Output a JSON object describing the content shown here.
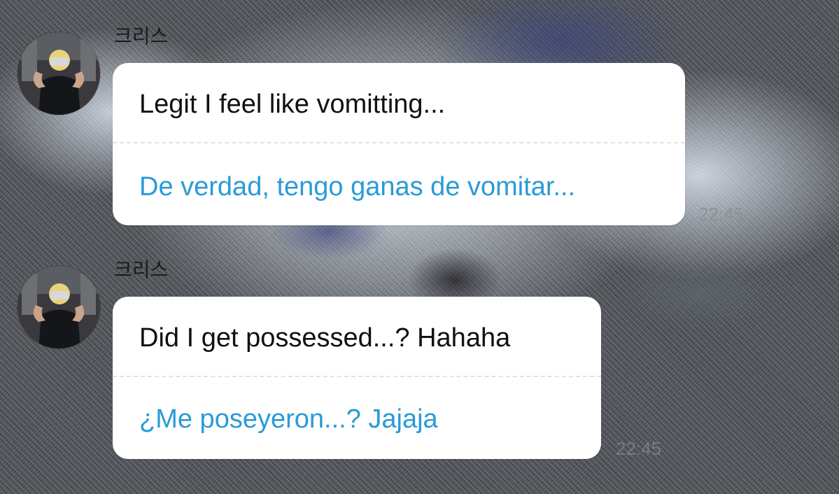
{
  "messages": [
    {
      "sender": "크리스",
      "original": "Legit I feel like vomitting...",
      "translation": "De verdad, tengo ganas de vomitar...",
      "time": "22:45"
    },
    {
      "sender": "크리스",
      "original": "Did I get possessed...? Hahaha",
      "translation": "¿Me poseyeron...? Jajaja",
      "time": "22:45"
    }
  ],
  "colors": {
    "original_text": "#111111",
    "translation_text": "#2a9bd6",
    "bubble": "#ffffff",
    "timestamp": "#8e9296"
  },
  "icons": {
    "avatar": "profile-photo"
  }
}
